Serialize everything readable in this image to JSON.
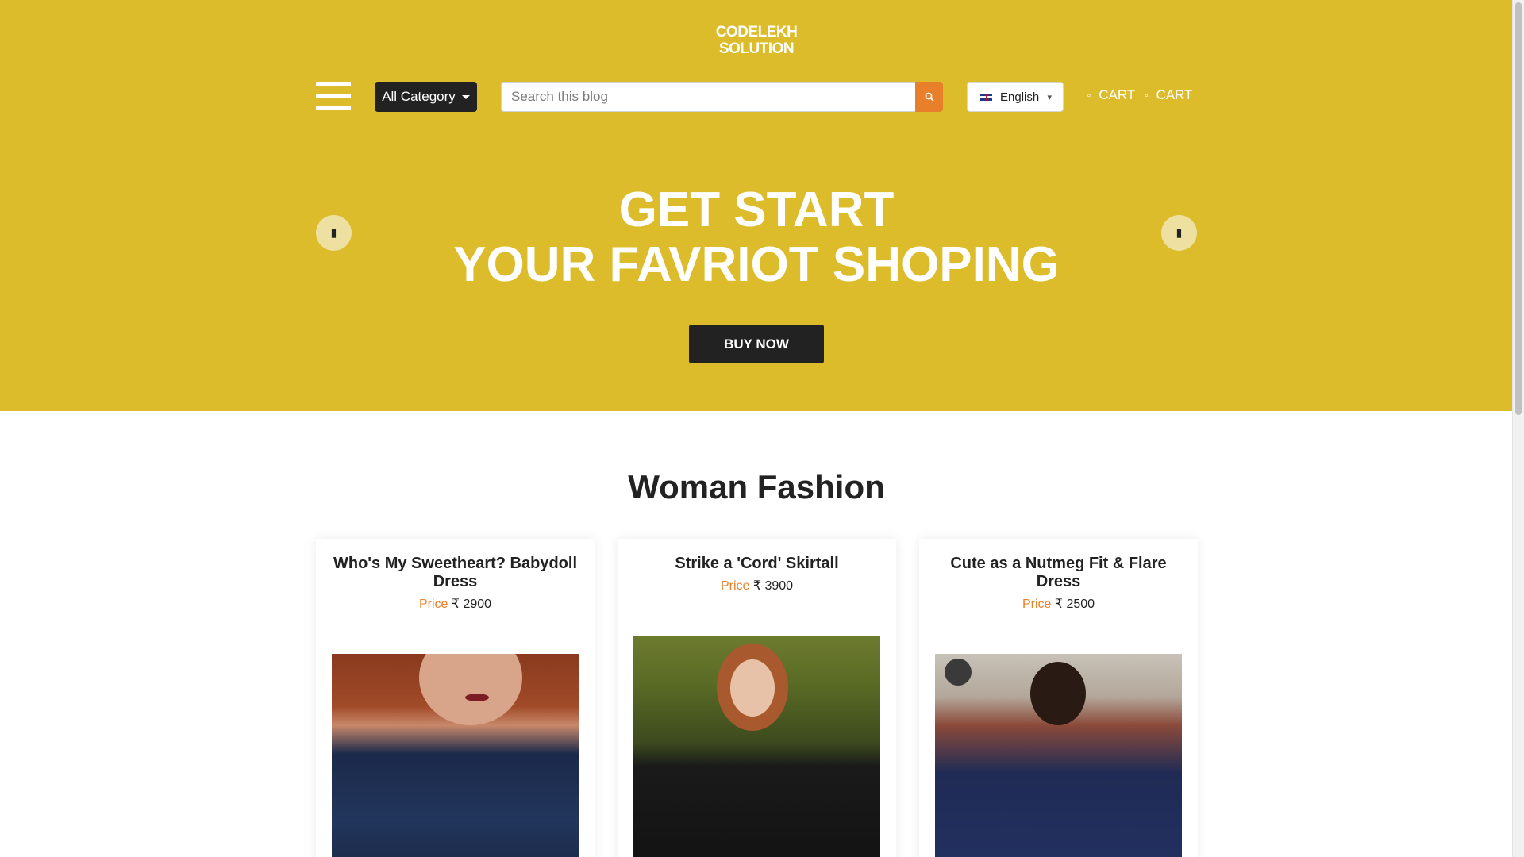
{
  "brand": {
    "logo_line1": "CODELEKH",
    "logo_line2": "SOLUTION"
  },
  "header": {
    "category_label": "All Category",
    "search_placeholder": "Search this blog",
    "language_label": "English",
    "cart_label_1": "CART",
    "cart_label_2": "CART"
  },
  "hero": {
    "title_line1": "GET START",
    "title_line2": "YOUR FAVRIOT SHOPING",
    "cta_label": "BUY NOW",
    "background_color": "#dcbc2a"
  },
  "section": {
    "title": "Woman Fashion"
  },
  "products": [
    {
      "name": "Who's My Sweetheart? Babydoll Dress",
      "price_label": "Price",
      "price": "₹ 2900"
    },
    {
      "name": "Strike a 'Cord' Skirtall",
      "price_label": "Price",
      "price": "₹ 3900"
    },
    {
      "name": "Cute as a Nutmeg Fit & Flare Dress",
      "price_label": "Price",
      "price": "₹ 2500"
    }
  ],
  "icons": {
    "menu": "hamburger-menu-icon",
    "search": "search-icon",
    "flag": "uk-flag-icon",
    "cart": "cart-icon",
    "prev": "chevron-left-icon",
    "next": "chevron-right-icon"
  }
}
